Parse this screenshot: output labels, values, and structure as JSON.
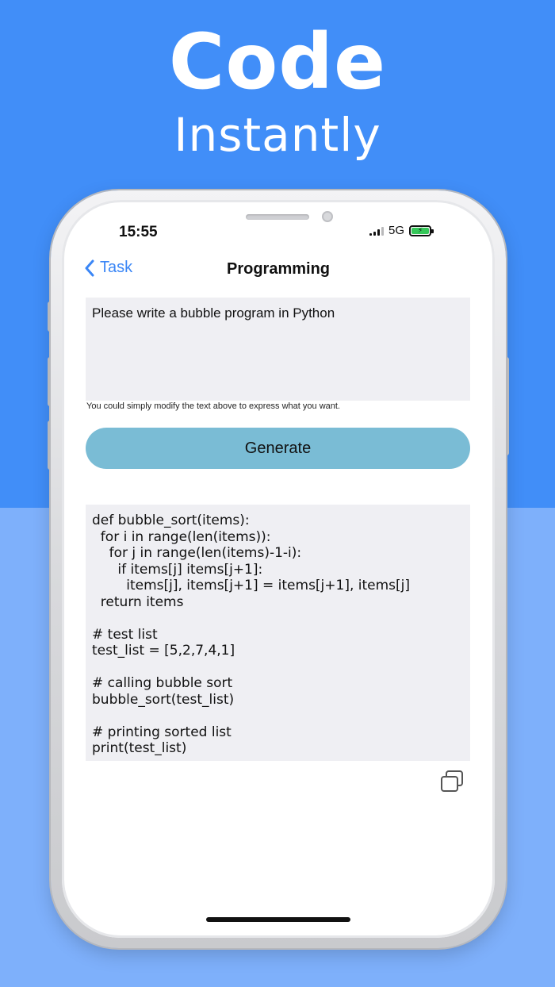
{
  "promo": {
    "headline": "Code",
    "subheadline": "Instantly"
  },
  "status_bar": {
    "time": "15:55",
    "network": "5G",
    "battery_icon": "battery-charging-icon",
    "signal_icon": "cellular-signal-icon"
  },
  "nav": {
    "back_label": "Task",
    "title": "Programming"
  },
  "prompt": {
    "value": "Please write a bubble program in Python",
    "hint": "You could simply modify the text above to express what you want."
  },
  "generate": {
    "label": "Generate"
  },
  "code_output": {
    "text": "def bubble_sort(items):\n  for i in range(len(items)):\n    for j in range(len(items)-1-i):\n      if items[j] items[j+1]:\n        items[j], items[j+1] = items[j+1], items[j]\n  return items\n\n# test list\ntest_list = [5,2,7,4,1]\n\n# calling bubble sort\nbubble_sort(test_list)\n\n# printing sorted list\nprint(test_list)"
  },
  "colors": {
    "background_top": "#418ef8",
    "background_bottom": "#7eb0fb",
    "accent": "#3a86f6",
    "generate_button": "#7abcd5"
  }
}
